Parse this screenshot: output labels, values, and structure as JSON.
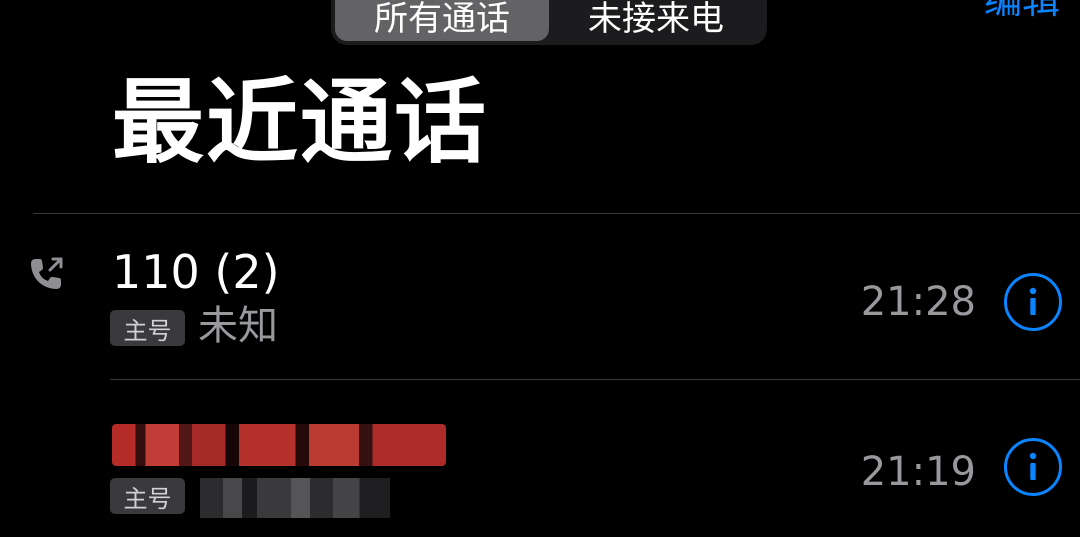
{
  "segmented": {
    "all_calls": "所有通话",
    "missed_calls": "未接来电"
  },
  "header": {
    "edit_label": "编辑",
    "title": "最近通话"
  },
  "calls": [
    {
      "name": "110 (2)",
      "sim_label": "主号",
      "type": "未知",
      "time": "21:28",
      "outgoing": true
    },
    {
      "name": "",
      "sim_label": "主号",
      "type": "",
      "time": "21:19",
      "outgoing": false
    }
  ],
  "colors": {
    "accent": "#0a84ff",
    "background": "#000000",
    "secondary_text": "#98989d"
  },
  "icons": {
    "call_direction": "outgoing-call-icon",
    "info": "info-circle-icon"
  }
}
